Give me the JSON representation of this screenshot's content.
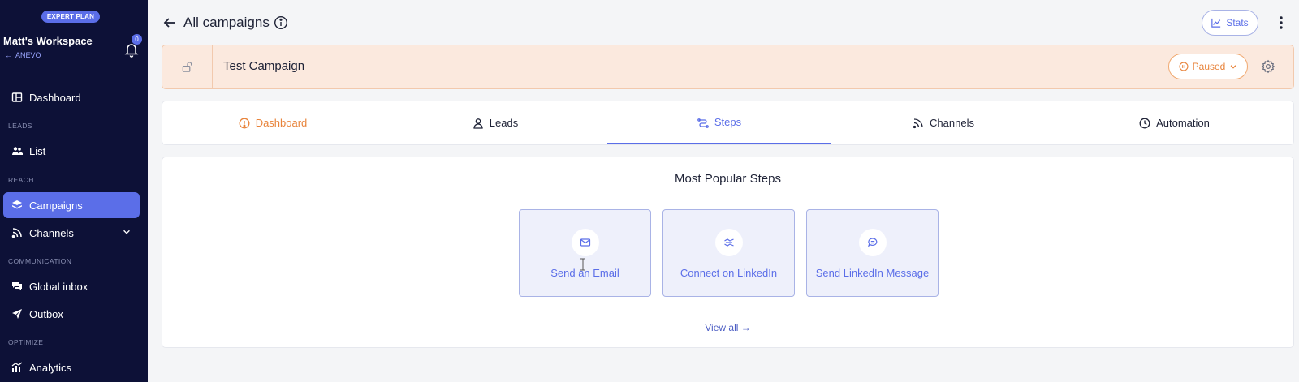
{
  "sidebar": {
    "plan_badge": "EXPERT PLAN",
    "workspace_name": "Matt's Workspace",
    "workspace_sub": "ANEVO",
    "notification_count": "0",
    "items": {
      "dashboard": "Dashboard",
      "list": "List",
      "campaigns": "Campaigns",
      "channels": "Channels",
      "global_inbox": "Global inbox",
      "outbox": "Outbox",
      "analytics": "Analytics"
    },
    "sections": {
      "leads": "LEADS",
      "reach": "REACH",
      "communication": "COMMUNICATION",
      "optimize": "OPTIMIZE"
    }
  },
  "header": {
    "title": "All campaigns",
    "stats_label": "Stats"
  },
  "campaign": {
    "name": "Test Campaign",
    "status": "Paused"
  },
  "tabs": {
    "dashboard": "Dashboard",
    "leads": "Leads",
    "steps": "Steps",
    "channels": "Channels",
    "automation": "Automation"
  },
  "steps": {
    "title": "Most Popular Steps",
    "cards": [
      "Send an Email",
      "Connect on LinkedIn",
      "Send LinkedIn Message"
    ],
    "view_all": "View all →"
  },
  "colors": {
    "sidebar_bg": "#0d1137",
    "accent": "#5b6ee8",
    "warning": "#e8833a",
    "banner_bg": "#fbe9de"
  }
}
